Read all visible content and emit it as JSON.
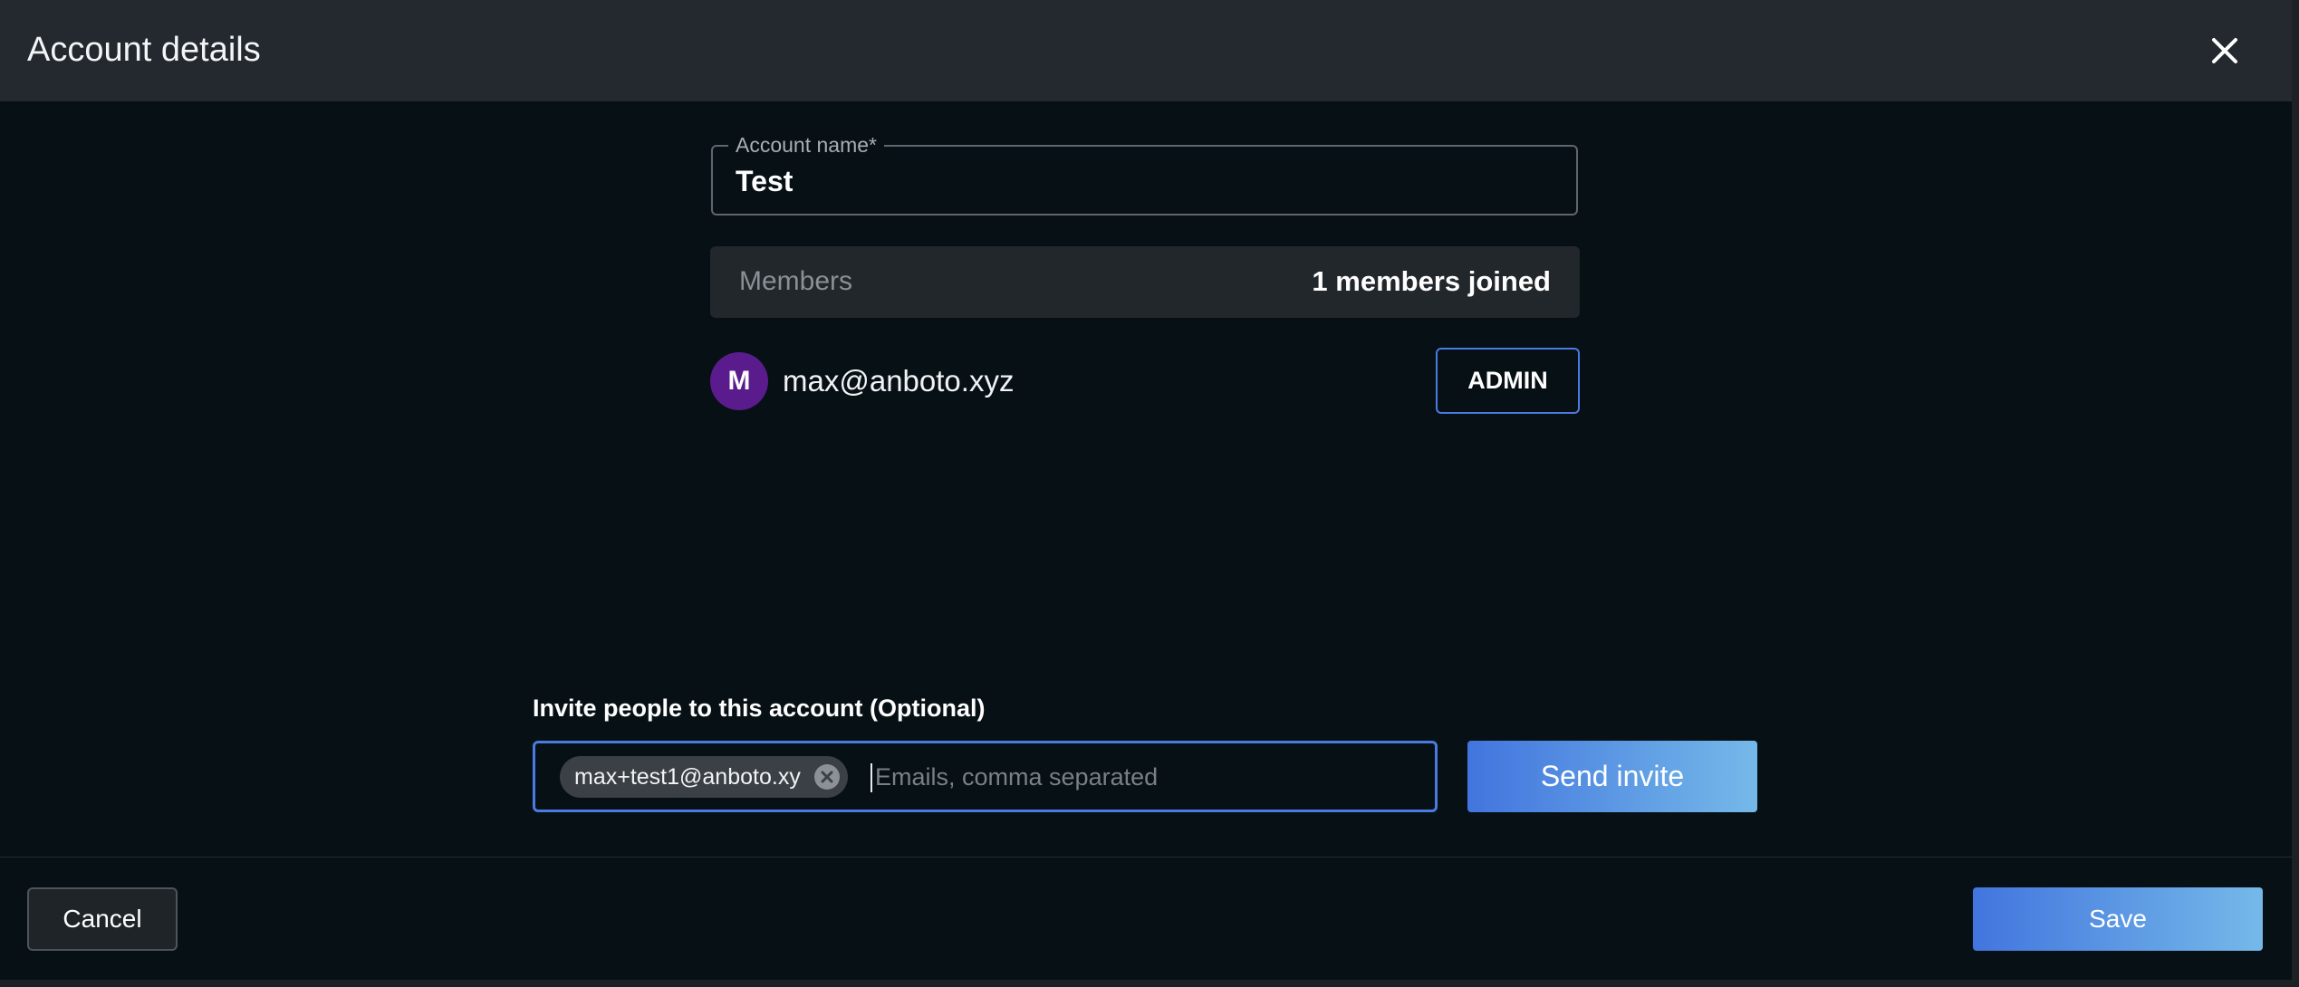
{
  "dialog": {
    "title": "Account details"
  },
  "account_name": {
    "label": "Account name*",
    "value": "Test"
  },
  "members": {
    "label": "Members",
    "count_text": "1 members joined",
    "list": [
      {
        "avatar_initial": "M",
        "avatar_color": "#5a1c8c",
        "email": "max@anboto.xyz",
        "role": "ADMIN"
      }
    ]
  },
  "invite": {
    "label": "Invite people to this account (Optional)",
    "chips": [
      "max+test1@anboto.xy"
    ],
    "placeholder": "Emails, comma separated",
    "send_label": "Send invite"
  },
  "footer": {
    "cancel_label": "Cancel",
    "save_label": "Save"
  },
  "colors": {
    "background": "#071015",
    "header": "#23292f",
    "accent": "#4a7be0",
    "button_gradient_start": "#4275de",
    "button_gradient_end": "#75b9e9"
  },
  "icons": {
    "close": "close-icon",
    "chip_remove": "chip-remove-icon"
  }
}
